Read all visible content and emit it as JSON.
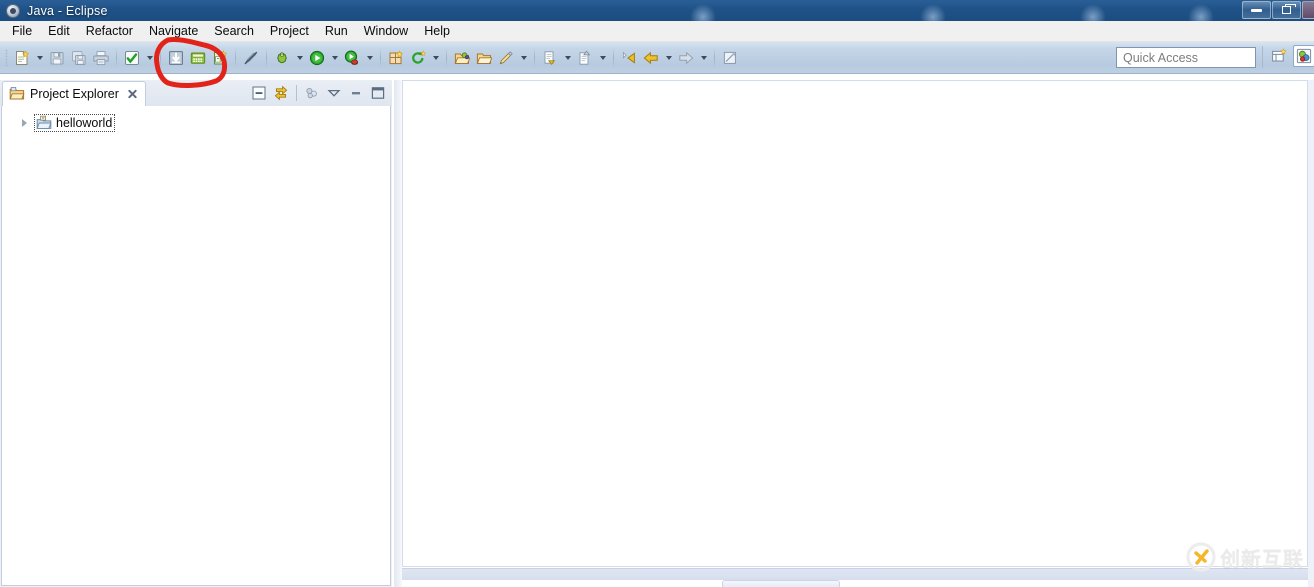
{
  "window": {
    "title": "Java - Eclipse",
    "app_icon": "eclipse-icon",
    "controls": {
      "minimize": "minimize-button",
      "restore": "restore-button",
      "close": "close-button"
    }
  },
  "menubar": {
    "items": [
      {
        "label": "File"
      },
      {
        "label": "Edit"
      },
      {
        "label": "Refactor"
      },
      {
        "label": "Navigate"
      },
      {
        "label": "Search"
      },
      {
        "label": "Project"
      },
      {
        "label": "Run"
      },
      {
        "label": "Window"
      },
      {
        "label": "Help"
      }
    ]
  },
  "toolbar": {
    "groups": [
      {
        "name": "file-group",
        "buttons": [
          {
            "icon": "new-wizard-icon",
            "label": "New",
            "has_dropdown": true
          },
          {
            "icon": "save-icon",
            "label": "Save",
            "has_dropdown": false
          },
          {
            "icon": "save-all-icon",
            "label": "Save All",
            "has_dropdown": false
          },
          {
            "icon": "print-icon",
            "label": "Print",
            "has_dropdown": false
          }
        ]
      },
      {
        "name": "build-group",
        "buttons": [
          {
            "icon": "build-all-icon",
            "label": "Build All",
            "has_dropdown": true
          }
        ]
      },
      {
        "name": "import-export-group",
        "buttons": [
          {
            "icon": "import-icon",
            "label": "Import",
            "has_dropdown": false
          },
          {
            "icon": "export-icon",
            "label": "Export",
            "has_dropdown": false
          },
          {
            "icon": "new-java-class-icon",
            "label": "New Java Class",
            "has_dropdown": false
          }
        ]
      },
      {
        "name": "toggle-group",
        "buttons": [
          {
            "icon": "toggle-mark-occurrences-icon",
            "label": "Toggle Mark Occurrences",
            "has_dropdown": false
          }
        ]
      },
      {
        "name": "launch-group",
        "buttons": [
          {
            "icon": "debug-icon",
            "label": "Debug",
            "has_dropdown": true
          },
          {
            "icon": "run-icon",
            "label": "Run",
            "has_dropdown": true
          },
          {
            "icon": "run-coverage-icon",
            "label": "Coverage",
            "has_dropdown": true
          }
        ]
      },
      {
        "name": "java-group",
        "buttons": [
          {
            "icon": "new-java-package-icon",
            "label": "New Java Package",
            "has_dropdown": false
          },
          {
            "icon": "external-tools-icon",
            "label": "External Tools",
            "has_dropdown": true
          }
        ]
      },
      {
        "name": "search-group",
        "buttons": [
          {
            "icon": "open-type-icon",
            "label": "Search",
            "has_dropdown": false
          },
          {
            "icon": "open-task-icon",
            "label": "Open Task",
            "has_dropdown": false
          },
          {
            "icon": "pencil-icon",
            "label": "Last Edit Location",
            "has_dropdown": true
          }
        ]
      },
      {
        "name": "annotation-nav-group",
        "buttons": [
          {
            "icon": "next-annotation-icon",
            "label": "Next Annotation",
            "has_dropdown": true
          },
          {
            "icon": "previous-annotation-icon",
            "label": "Previous Annotation",
            "has_dropdown": true
          }
        ]
      },
      {
        "name": "history-group",
        "buttons": [
          {
            "icon": "back-edit-icon",
            "label": "Back to",
            "has_dropdown": false
          },
          {
            "icon": "back-arrow-icon",
            "label": "Back",
            "has_dropdown": true
          },
          {
            "icon": "forward-arrow-icon",
            "label": "Forward",
            "has_dropdown": true
          }
        ]
      },
      {
        "name": "pin-group",
        "buttons": [
          {
            "icon": "pin-editor-icon",
            "label": "Pin Editor",
            "has_dropdown": false
          }
        ]
      }
    ]
  },
  "quick_access": {
    "placeholder": "Quick Access",
    "value": ""
  },
  "perspective_bar": {
    "buttons": [
      {
        "icon": "open-perspective-icon",
        "label": "Open Perspective"
      },
      {
        "icon": "java-perspective-icon",
        "label": "Java"
      }
    ]
  },
  "project_explorer": {
    "tab": {
      "icon": "project-explorer-icon",
      "label": "Project Explorer",
      "close": "close-icon"
    },
    "view_toolbar": [
      {
        "icon": "collapse-all-icon",
        "label": "Collapse All"
      },
      {
        "icon": "link-with-editor-icon",
        "label": "Link with Editor"
      },
      {
        "icon": "focus-on-active-task-icon",
        "label": "Focus on Active Task"
      },
      {
        "icon": "view-menu-icon",
        "label": "View Menu"
      },
      {
        "icon": "minimize-icon",
        "label": "Minimize"
      },
      {
        "icon": "maximize-icon",
        "label": "Maximize"
      }
    ],
    "tree": [
      {
        "label": "helloworld",
        "icon": "java-project-icon",
        "expanded": false,
        "selected": true,
        "indent": 0
      }
    ]
  },
  "editor_area": {
    "content": "",
    "open_editors": []
  },
  "annotation": {
    "type": "hand-drawn-circle",
    "color": "#e2231a",
    "stroke_width": 5,
    "targets": [
      "import-icon",
      "export-icon"
    ]
  },
  "watermark": {
    "text": "创新互联",
    "logo_color": "#f5b31d",
    "text_color": "#e9e9e9"
  }
}
